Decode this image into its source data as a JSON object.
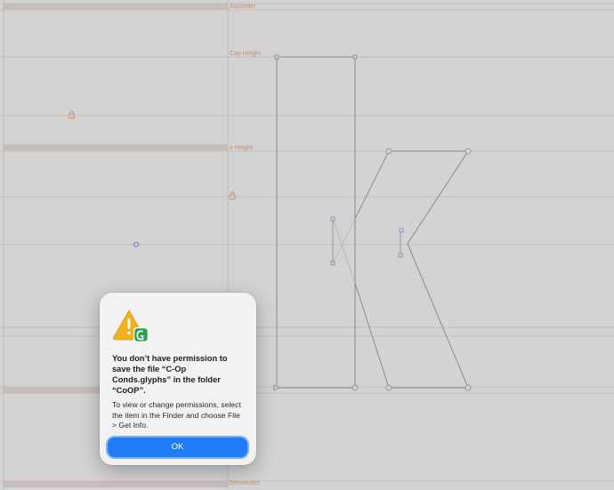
{
  "metrics": {
    "ascender": "Ascender",
    "cap_height": "Cap Height",
    "x_height": "x-Height",
    "descender": "Descender"
  },
  "dialog": {
    "title": "You don’t have permission to save the file “C-Op Conds.glyphs” in the folder “CoOP”.",
    "message": "To view or change permissions, select the item in the Finder and choose File > Get Info.",
    "ok_label": "OK",
    "icon": "warning-with-glyphs-app-icon"
  },
  "colors": {
    "accent": "#1f7cf5",
    "metric": "#c98f6a",
    "warning": "#f3b21b",
    "app": "#2ba24b"
  }
}
